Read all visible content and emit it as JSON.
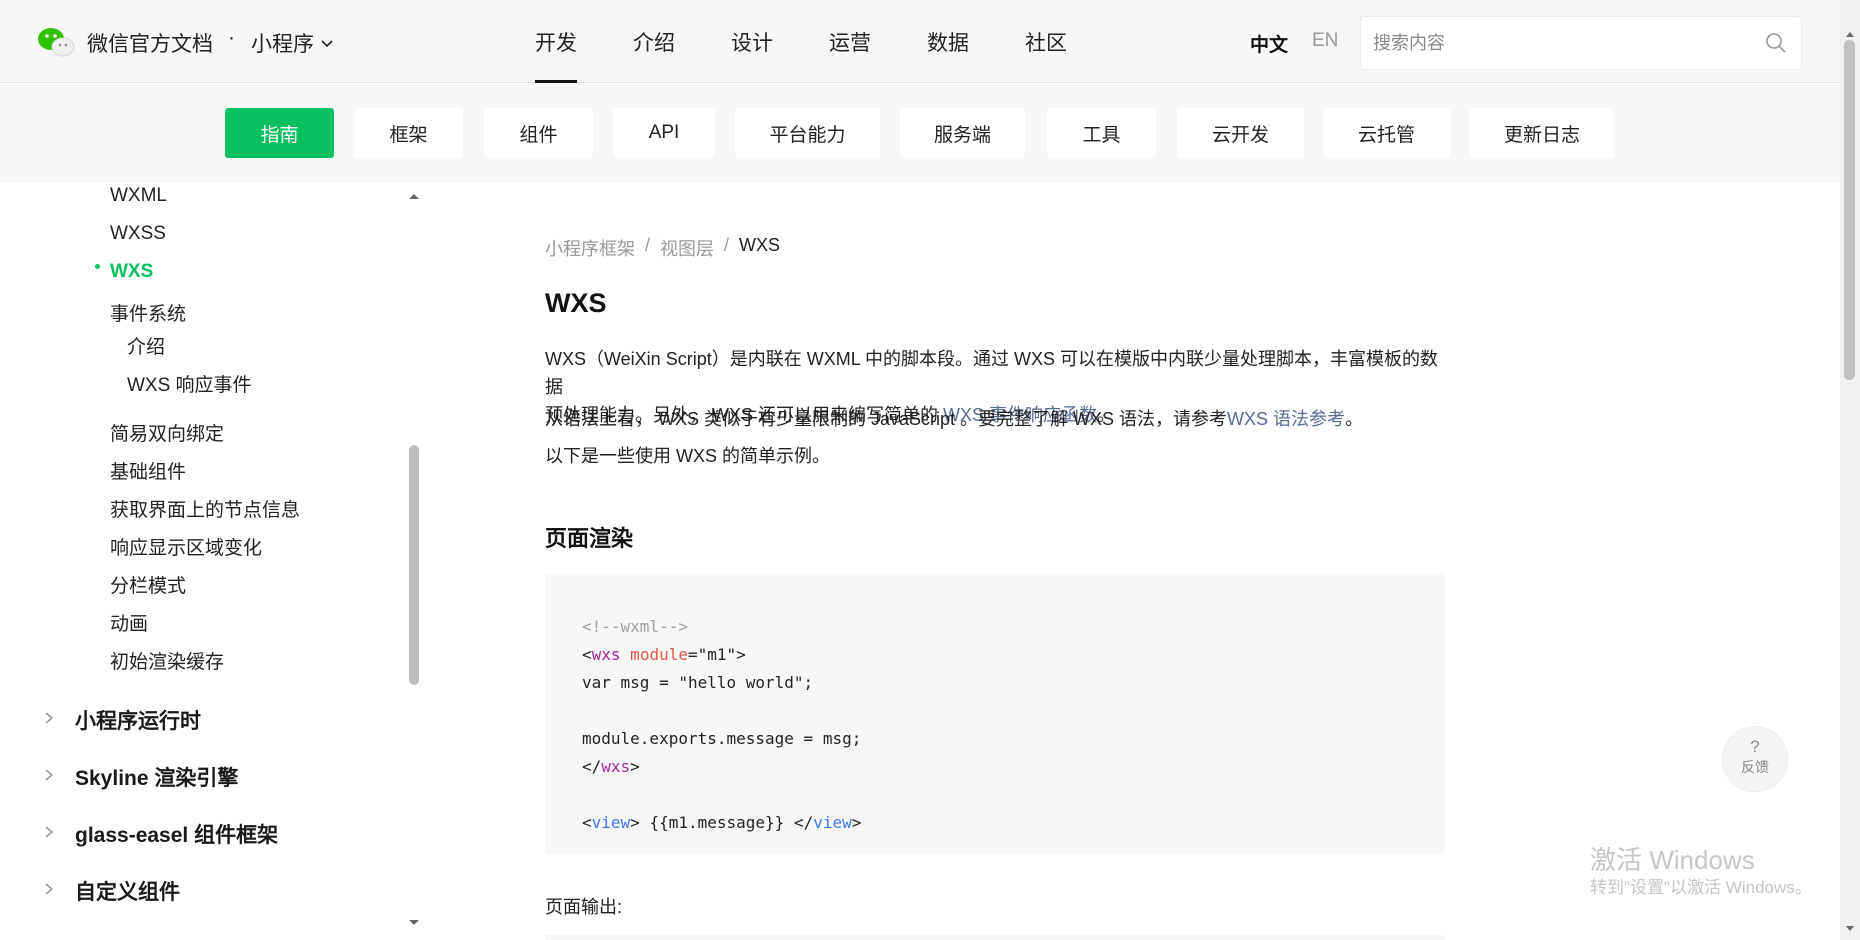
{
  "header": {
    "brand": "微信官方文档",
    "separator": "·",
    "product": "小程序",
    "nav": [
      "开发",
      "介绍",
      "设计",
      "运营",
      "数据",
      "社区"
    ],
    "active_nav": "开发",
    "lang_zh": "中文",
    "lang_en": "EN",
    "search_placeholder": "搜索内容"
  },
  "categories": [
    "指南",
    "框架",
    "组件",
    "API",
    "平台能力",
    "服务端",
    "工具",
    "云开发",
    "云托管",
    "更新日志"
  ],
  "active_category": "指南",
  "sidebar": {
    "items": [
      "WXML",
      "WXSS",
      "WXS",
      "事件系统",
      "介绍",
      "WXS 响应事件",
      "简易双向绑定",
      "基础组件",
      "获取界面上的节点信息",
      "响应显示区域变化",
      "分栏模式",
      "动画",
      "初始渲染缓存"
    ],
    "active_item": "WXS",
    "sections": [
      "小程序运行时",
      "Skyline 渲染引擎",
      "glass-easel 组件框架",
      "自定义组件"
    ]
  },
  "main": {
    "breadcrumb": [
      "小程序框架",
      "/",
      "视图层",
      "/",
      "WXS"
    ],
    "title": "WXS",
    "p1_line1": "WXS（WeiXin Script）是内联在 WXML 中的脚本段。通过 WXS 可以在模版中内联少量处理脚本，丰富模板的数据",
    "p1_line2": "预处理能力。另外， WXS 还可以用来编写简单的 ",
    "p1_link": "WXS 事件响应函数",
    "p1_end": "。",
    "p2_text": "从语法上看， WXS 类似于有少量限制的 JavaScript 。要完整了解 WXS 语法，请参考",
    "p2_link": "WXS 语法参考",
    "p2_end": "。",
    "p3": "以下是一些使用 WXS 的简单示例。",
    "section_title": "页面渲染",
    "code": {
      "l1": "<!--wxml-->",
      "l2_lt": "<",
      "l2_tag": "wxs",
      "l2_attr": " module",
      "l2_rest": "=\"m1\">",
      "l3": "var msg = \"hello world\";",
      "l4": "module.exports.message = msg;",
      "l5_lt": "</",
      "l5_tag": "wxs",
      "l5_gt": ">",
      "l6_lt": "<",
      "l6_tag": "view",
      "l6_mid": "> {{m1.message}} </",
      "l6_tag2": "view",
      "l6_gt": ">"
    },
    "output_label": "页面输出:"
  },
  "feedback": {
    "icon": "?",
    "label": "反馈"
  },
  "watermark": {
    "line1": "激活 Windows",
    "line2": "转到\"设置\"以激活 Windows。"
  },
  "colors": {
    "accent": "#07c160",
    "link": "#576b95"
  }
}
